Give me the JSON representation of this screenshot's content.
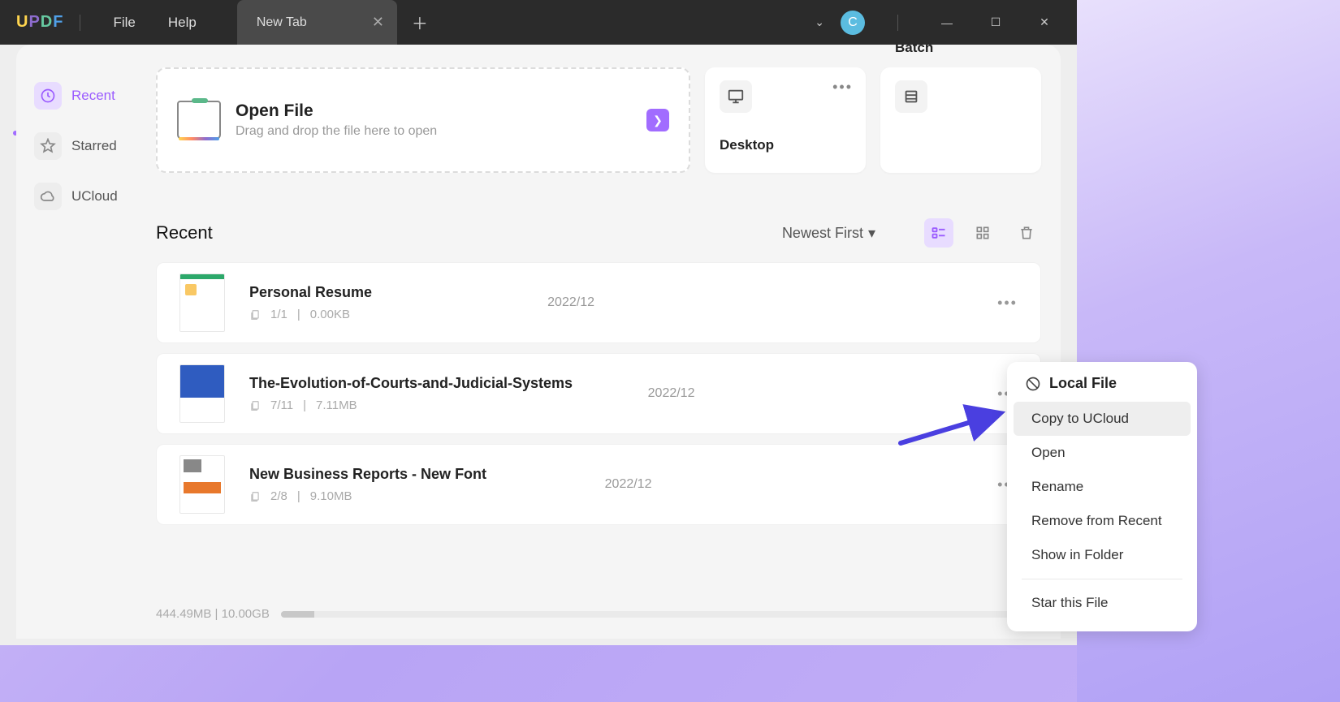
{
  "logo": "UPDF",
  "menu": {
    "file": "File",
    "help": "Help"
  },
  "tab": {
    "title": "New Tab"
  },
  "avatar_letter": "C",
  "sidebar": {
    "items": [
      {
        "key": "recent",
        "label": "Recent",
        "active": true
      },
      {
        "key": "starred",
        "label": "Starred",
        "active": false
      },
      {
        "key": "ucloud",
        "label": "UCloud",
        "active": false
      }
    ]
  },
  "open_card": {
    "title": "Open File",
    "subtitle": "Drag and drop the file here to open"
  },
  "mini_cards": {
    "desktop": "Desktop",
    "batch": "Batch"
  },
  "list": {
    "header": "Recent",
    "sort": "Newest First",
    "files": [
      {
        "name": "Personal Resume",
        "pages": "1/1",
        "size": "0.00KB",
        "date": "2022/12"
      },
      {
        "name": "The-Evolution-of-Courts-and-Judicial-Systems",
        "pages": "7/11",
        "size": "7.11MB",
        "date": "2022/12"
      },
      {
        "name": "New Business Reports - New Font",
        "pages": "2/8",
        "size": "9.10MB",
        "date": "2022/12"
      }
    ]
  },
  "storage": "444.49MB | 10.00GB",
  "context_menu": {
    "header": "Local File",
    "items": [
      "Copy to UCloud",
      "Open",
      "Rename",
      "Remove from Recent",
      "Show in Folder",
      "Star this File"
    ]
  }
}
